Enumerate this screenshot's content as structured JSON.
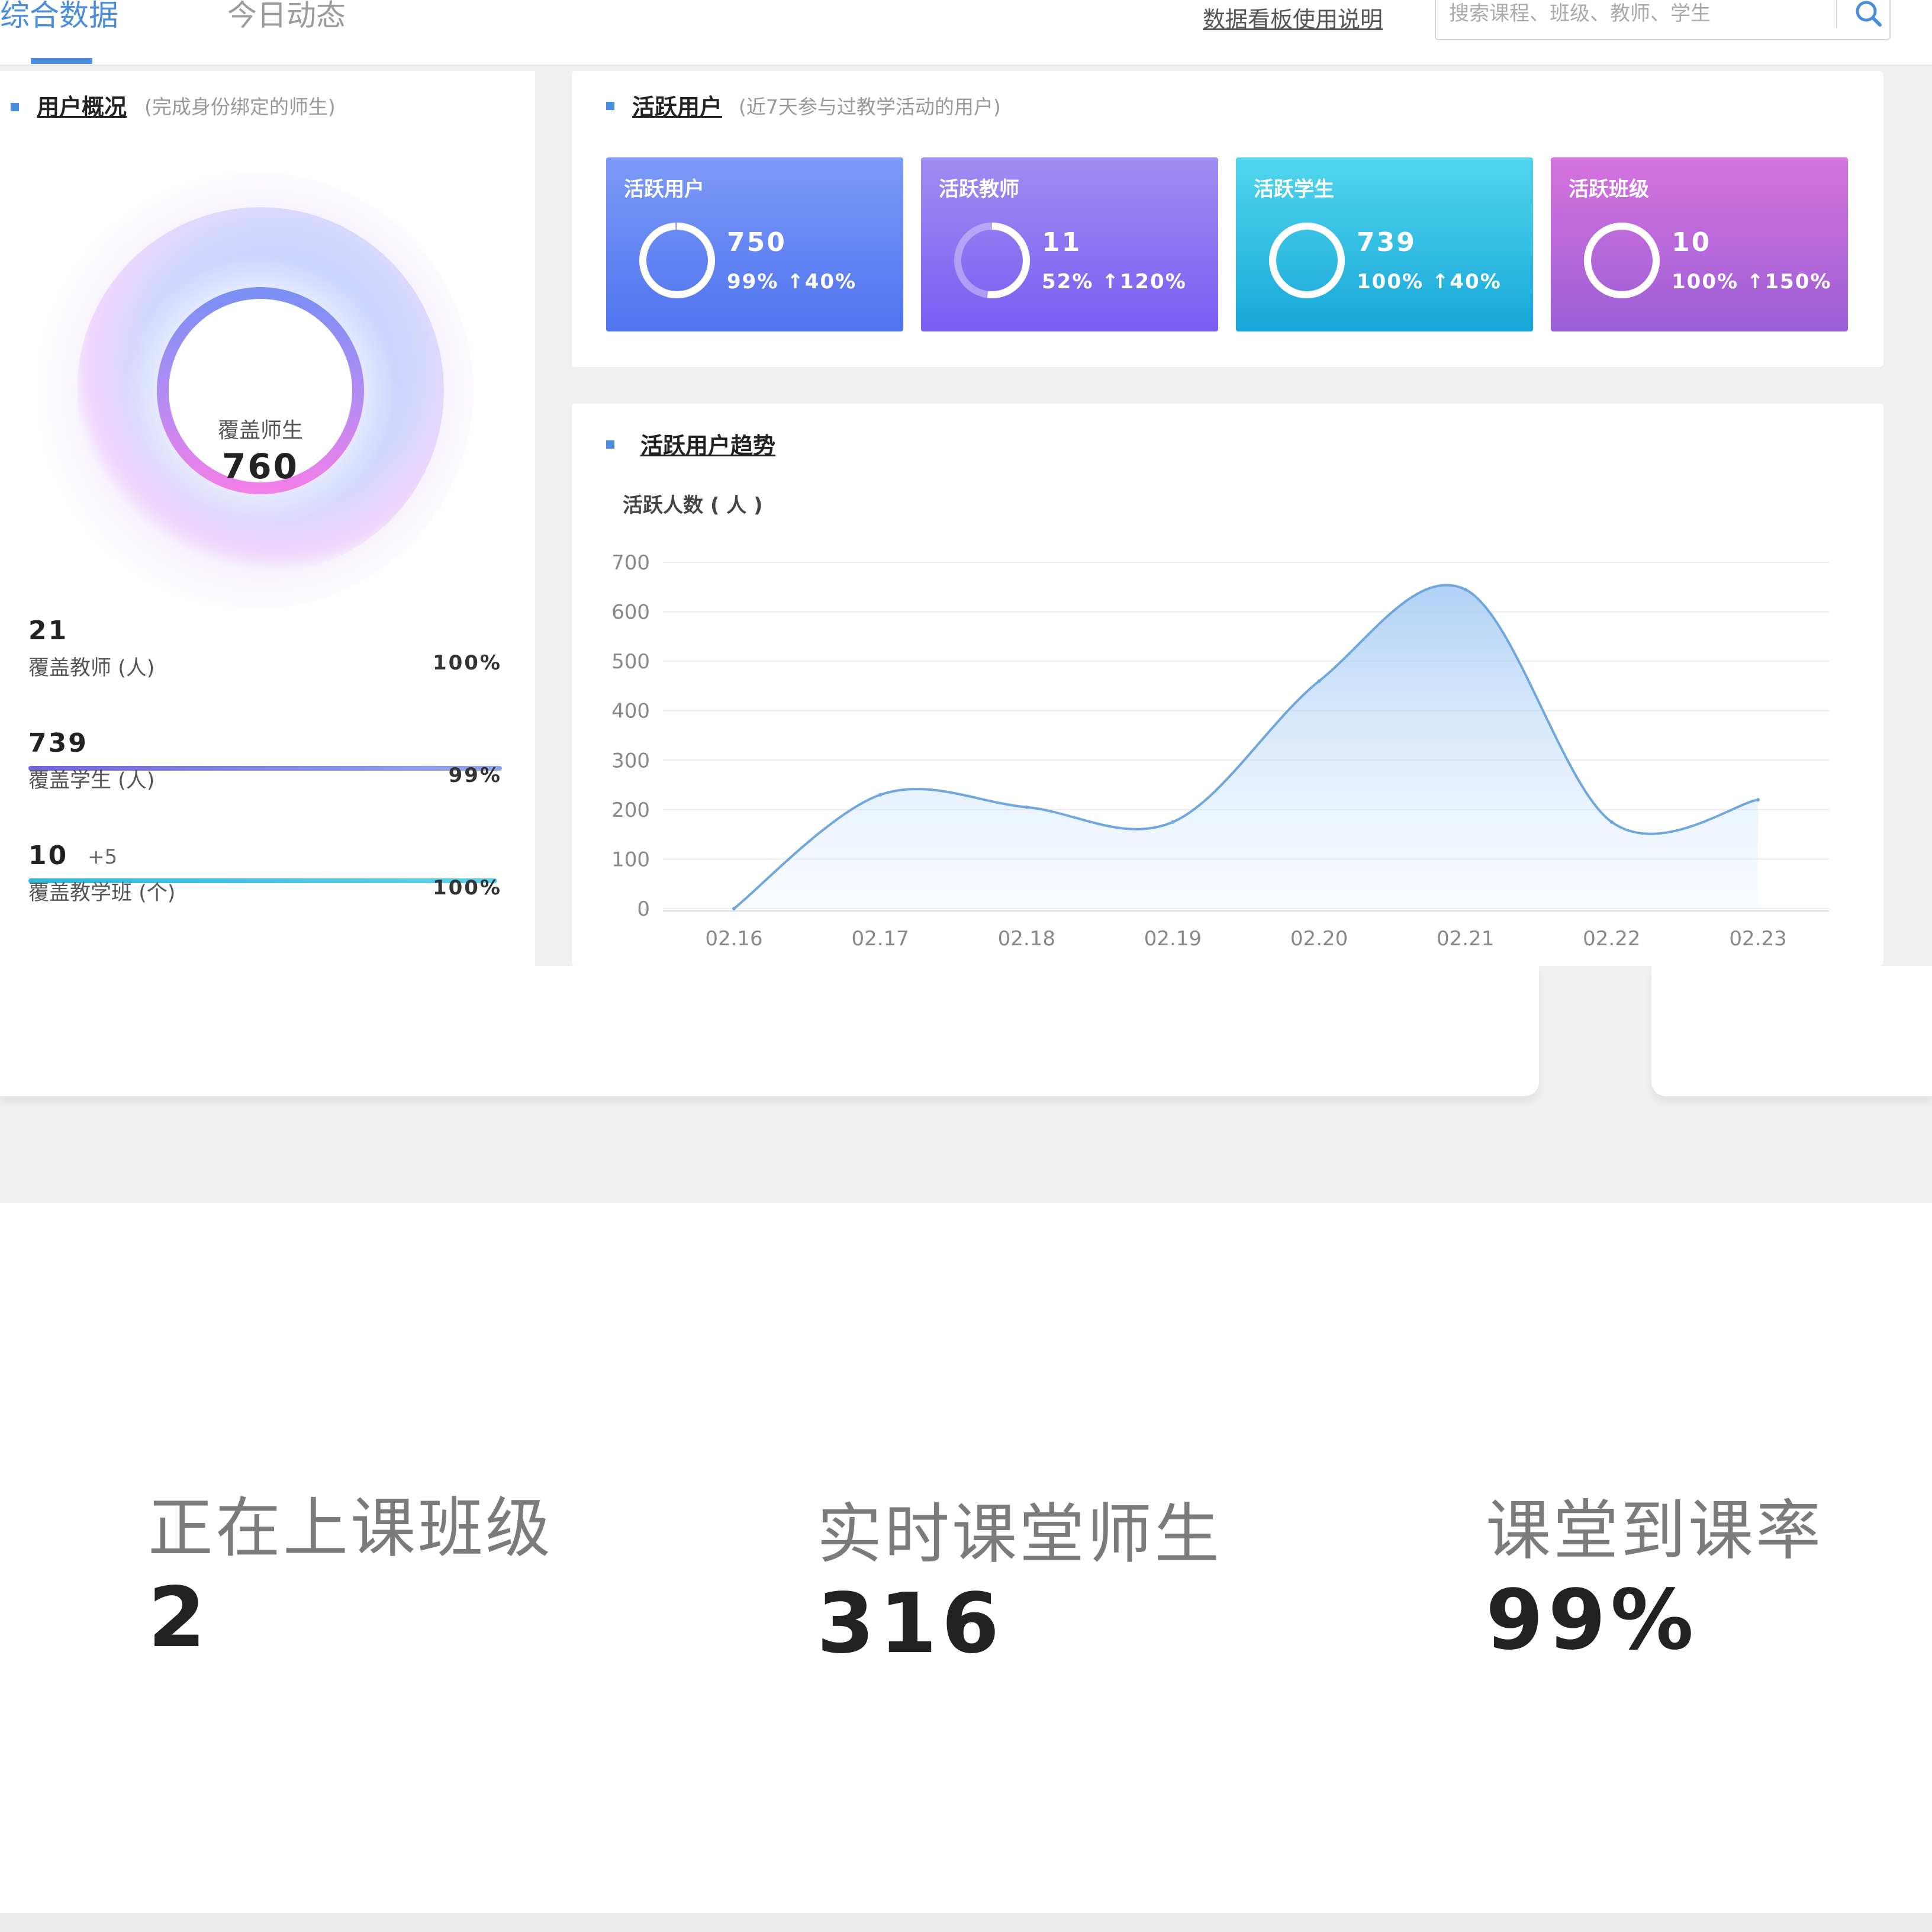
{
  "tabs": [
    {
      "label": "综合数据",
      "active": true
    },
    {
      "label": "今日动态",
      "active": false
    }
  ],
  "header": {
    "help_link": "数据看板使用说明",
    "search_placeholder": "搜索课程、班级、教师、学生"
  },
  "colors": {
    "accent": "#4a8ddc",
    "card_blue": "#5a86f5",
    "card_purple": "#8e6cf2",
    "card_cyan": "#2bbbe0",
    "card_magenta": "#b862e0"
  },
  "overview": {
    "title": "用户概况",
    "subtitle": "(完成身份绑定的师生)",
    "donut_label": "覆盖师生",
    "donut_value": "760",
    "stats": [
      {
        "value": "21",
        "extra": "",
        "label": "覆盖教师 (人)",
        "pct": "100%",
        "fill": 1.0
      },
      {
        "value": "739",
        "extra": "",
        "label": "覆盖学生 (人)",
        "pct": "99%",
        "fill": 0.99
      },
      {
        "value": "10",
        "extra": "+5",
        "label": "覆盖教学班 (个)",
        "pct": "100%",
        "fill": 1.0
      }
    ]
  },
  "active": {
    "title": "活跃用户",
    "subtitle": "(近7天参与过教学活动的用户)",
    "cards": [
      {
        "title": "活跃用户",
        "value": "750",
        "pct": "99%",
        "growth": "↑40%",
        "ring": 0.99
      },
      {
        "title": "活跃教师",
        "value": "11",
        "pct": "52%",
        "growth": "↑120%",
        "ring": 0.52
      },
      {
        "title": "活跃学生",
        "value": "739",
        "pct": "100%",
        "growth": "↑40%",
        "ring": 1.0
      },
      {
        "title": "活跃班级",
        "value": "10",
        "pct": "100%",
        "growth": "↑150%",
        "ring": 1.0
      }
    ]
  },
  "trend": {
    "title": "活跃用户趋势"
  },
  "chart_data": {
    "type": "area",
    "ylabel": "活跃人数 ( 人 )",
    "categories": [
      "02.16",
      "02.17",
      "02.18",
      "02.19",
      "02.20",
      "02.21",
      "02.22",
      "02.23"
    ],
    "values": [
      0,
      230,
      205,
      175,
      460,
      645,
      175,
      220
    ],
    "ylim": [
      0,
      700
    ],
    "yticks": [
      "700",
      "600",
      "500",
      "400",
      "300",
      "200",
      "100",
      "0"
    ],
    "grid": true
  },
  "live": [
    {
      "label": "正在上课班级",
      "value": "2"
    },
    {
      "label": "实时课堂师生",
      "value": "316"
    },
    {
      "label": "课堂到课率",
      "value": "99%"
    }
  ]
}
